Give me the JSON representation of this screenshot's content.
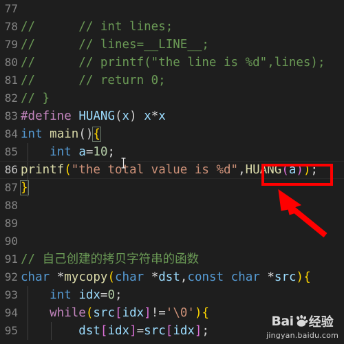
{
  "editor": {
    "background_color": "#1e1e1e",
    "gutter_color": "#858585",
    "annotation_color": "#ff0000",
    "lines": [
      {
        "num": "77",
        "segments": []
      },
      {
        "num": "78",
        "segments": [
          {
            "t": "//      // int lines;",
            "c": "cmt"
          }
        ]
      },
      {
        "num": "79",
        "segments": [
          {
            "t": "//      // lines=__LINE__;",
            "c": "cmt"
          }
        ]
      },
      {
        "num": "80",
        "segments": [
          {
            "t": "//      // printf(\"the line is %d\",lines);",
            "c": "cmt"
          }
        ]
      },
      {
        "num": "81",
        "segments": [
          {
            "t": "//      // return 0;",
            "c": "cmt"
          }
        ]
      },
      {
        "num": "82",
        "segments": [
          {
            "t": "// }",
            "c": "cmt"
          }
        ]
      },
      {
        "num": "83",
        "segments": [
          {
            "t": "#define",
            "c": "pre"
          },
          {
            "t": " ",
            "c": "punc"
          },
          {
            "t": "HUANG",
            "c": "var"
          },
          {
            "t": "(",
            "c": "punc"
          },
          {
            "t": "x",
            "c": "var"
          },
          {
            "t": ")",
            "c": "punc"
          },
          {
            "t": " ",
            "c": "punc"
          },
          {
            "t": "x",
            "c": "var"
          },
          {
            "t": "*",
            "c": "punc"
          },
          {
            "t": "x",
            "c": "var"
          }
        ]
      },
      {
        "num": "84",
        "segments": [
          {
            "t": "int",
            "c": "kw"
          },
          {
            "t": " ",
            "c": "punc"
          },
          {
            "t": "main",
            "c": "fn"
          },
          {
            "t": "()",
            "c": "punc"
          },
          {
            "t": "{",
            "c": "brkt1 bmatch"
          }
        ]
      },
      {
        "num": "85",
        "segments": [
          {
            "t": "    ",
            "c": "punc"
          },
          {
            "t": "int",
            "c": "kw"
          },
          {
            "t": " ",
            "c": "punc"
          },
          {
            "t": "a",
            "c": "var"
          },
          {
            "t": "=",
            "c": "punc"
          },
          {
            "t": "10",
            "c": "num"
          },
          {
            "t": ";",
            "c": "punc"
          }
        ]
      },
      {
        "num": "86",
        "current": true,
        "segments": [
          {
            "t": "printf",
            "c": "fn"
          },
          {
            "t": "(",
            "c": "brkt1"
          },
          {
            "t": "\"the total value is %d\"",
            "c": "str"
          },
          {
            "t": ",",
            "c": "punc"
          },
          {
            "t": "HUANG",
            "c": "fn"
          },
          {
            "t": "(",
            "c": "brkt2"
          },
          {
            "t": "a",
            "c": "var"
          },
          {
            "t": ")",
            "c": "brkt2"
          },
          {
            "t": ")",
            "c": "brkt1"
          },
          {
            "t": ";",
            "c": "punc"
          }
        ]
      },
      {
        "num": "87",
        "segments": [
          {
            "t": "}",
            "c": "brkt1 bmatch"
          }
        ]
      },
      {
        "num": "88",
        "segments": []
      },
      {
        "num": "89",
        "segments": []
      },
      {
        "num": "90",
        "segments": []
      },
      {
        "num": "91",
        "segments": [
          {
            "t": "// 自己创建的拷贝字符串的函数",
            "c": "cmt"
          }
        ]
      },
      {
        "num": "92",
        "segments": [
          {
            "t": "char",
            "c": "kw"
          },
          {
            "t": " ",
            "c": "punc"
          },
          {
            "t": "*",
            "c": "punc"
          },
          {
            "t": "mycopy",
            "c": "fn"
          },
          {
            "t": "(",
            "c": "brkt1"
          },
          {
            "t": "char",
            "c": "kw"
          },
          {
            "t": " ",
            "c": "punc"
          },
          {
            "t": "*",
            "c": "punc"
          },
          {
            "t": "dst",
            "c": "var"
          },
          {
            "t": ",",
            "c": "punc"
          },
          {
            "t": "const",
            "c": "kw"
          },
          {
            "t": " ",
            "c": "punc"
          },
          {
            "t": "char",
            "c": "kw"
          },
          {
            "t": " ",
            "c": "punc"
          },
          {
            "t": "*",
            "c": "punc"
          },
          {
            "t": "src",
            "c": "var"
          },
          {
            "t": ")",
            "c": "brkt1"
          },
          {
            "t": "{",
            "c": "brkt1"
          }
        ]
      },
      {
        "num": "93",
        "segments": [
          {
            "t": "    ",
            "c": "punc"
          },
          {
            "t": "int",
            "c": "kw"
          },
          {
            "t": " ",
            "c": "punc"
          },
          {
            "t": "idx",
            "c": "var"
          },
          {
            "t": "=",
            "c": "punc"
          },
          {
            "t": "0",
            "c": "num"
          },
          {
            "t": ";",
            "c": "punc"
          }
        ]
      },
      {
        "num": "94",
        "segments": [
          {
            "t": "    ",
            "c": "punc"
          },
          {
            "t": "while",
            "c": "ctl"
          },
          {
            "t": "(",
            "c": "brkt1"
          },
          {
            "t": "src",
            "c": "var"
          },
          {
            "t": "[",
            "c": "brkt2"
          },
          {
            "t": "idx",
            "c": "var"
          },
          {
            "t": "]",
            "c": "brkt2"
          },
          {
            "t": "!=",
            "c": "punc"
          },
          {
            "t": "'\\0'",
            "c": "str"
          },
          {
            "t": ")",
            "c": "brkt1"
          },
          {
            "t": "{",
            "c": "brkt1"
          }
        ]
      },
      {
        "num": "95",
        "segments": [
          {
            "t": "        ",
            "c": "punc"
          },
          {
            "t": "dst",
            "c": "var"
          },
          {
            "t": "[",
            "c": "brkt2"
          },
          {
            "t": "idx",
            "c": "var"
          },
          {
            "t": "]",
            "c": "brkt2"
          },
          {
            "t": "=",
            "c": "punc"
          },
          {
            "t": "src",
            "c": "var"
          },
          {
            "t": "[",
            "c": "brkt2"
          },
          {
            "t": "idx",
            "c": "var"
          },
          {
            "t": "]",
            "c": "brkt2"
          },
          {
            "t": ";",
            "c": "punc"
          }
        ]
      }
    ]
  },
  "annotation": {
    "highlighted_text": "HUANG(a)",
    "box_color": "#ff0000",
    "arrow_color": "#ff0000"
  },
  "watermark": {
    "brand_latin": "Bai",
    "brand_cn": "经验",
    "url": "jingyan.baidu.com"
  }
}
